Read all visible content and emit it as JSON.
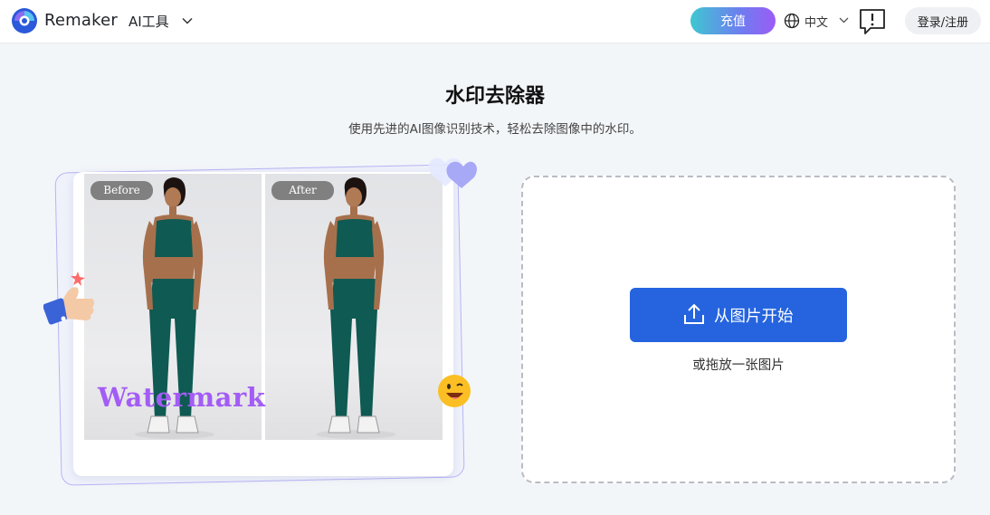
{
  "header": {
    "brand": "Remaker",
    "ai_tools_label": "AI工具",
    "recharge_label": "充值",
    "language_label": "中文",
    "login_label": "登录/注册"
  },
  "main": {
    "title": "水印去除器",
    "subtitle": "使用先进的AI图像识别技术，轻松去除图像中的水印。"
  },
  "demo": {
    "before_tag": "Before",
    "after_tag": "After",
    "watermark_text": "Watermark"
  },
  "upload": {
    "button_label": "从图片开始",
    "drop_hint": "或拖放一张图片"
  },
  "colors": {
    "primary_button": "#2564de",
    "recharge_gradient_start": "#3fc6d2",
    "recharge_gradient_end": "#9b5cf6",
    "watermark": "#a35cf5",
    "page_background": "#f3f6f9"
  },
  "icons": [
    "remaker-logo-icon",
    "chevron-down-icon",
    "globe-icon",
    "feedback-icon",
    "upload-icon",
    "heart-icon",
    "thumbs-up-icon",
    "smiley-icon"
  ]
}
